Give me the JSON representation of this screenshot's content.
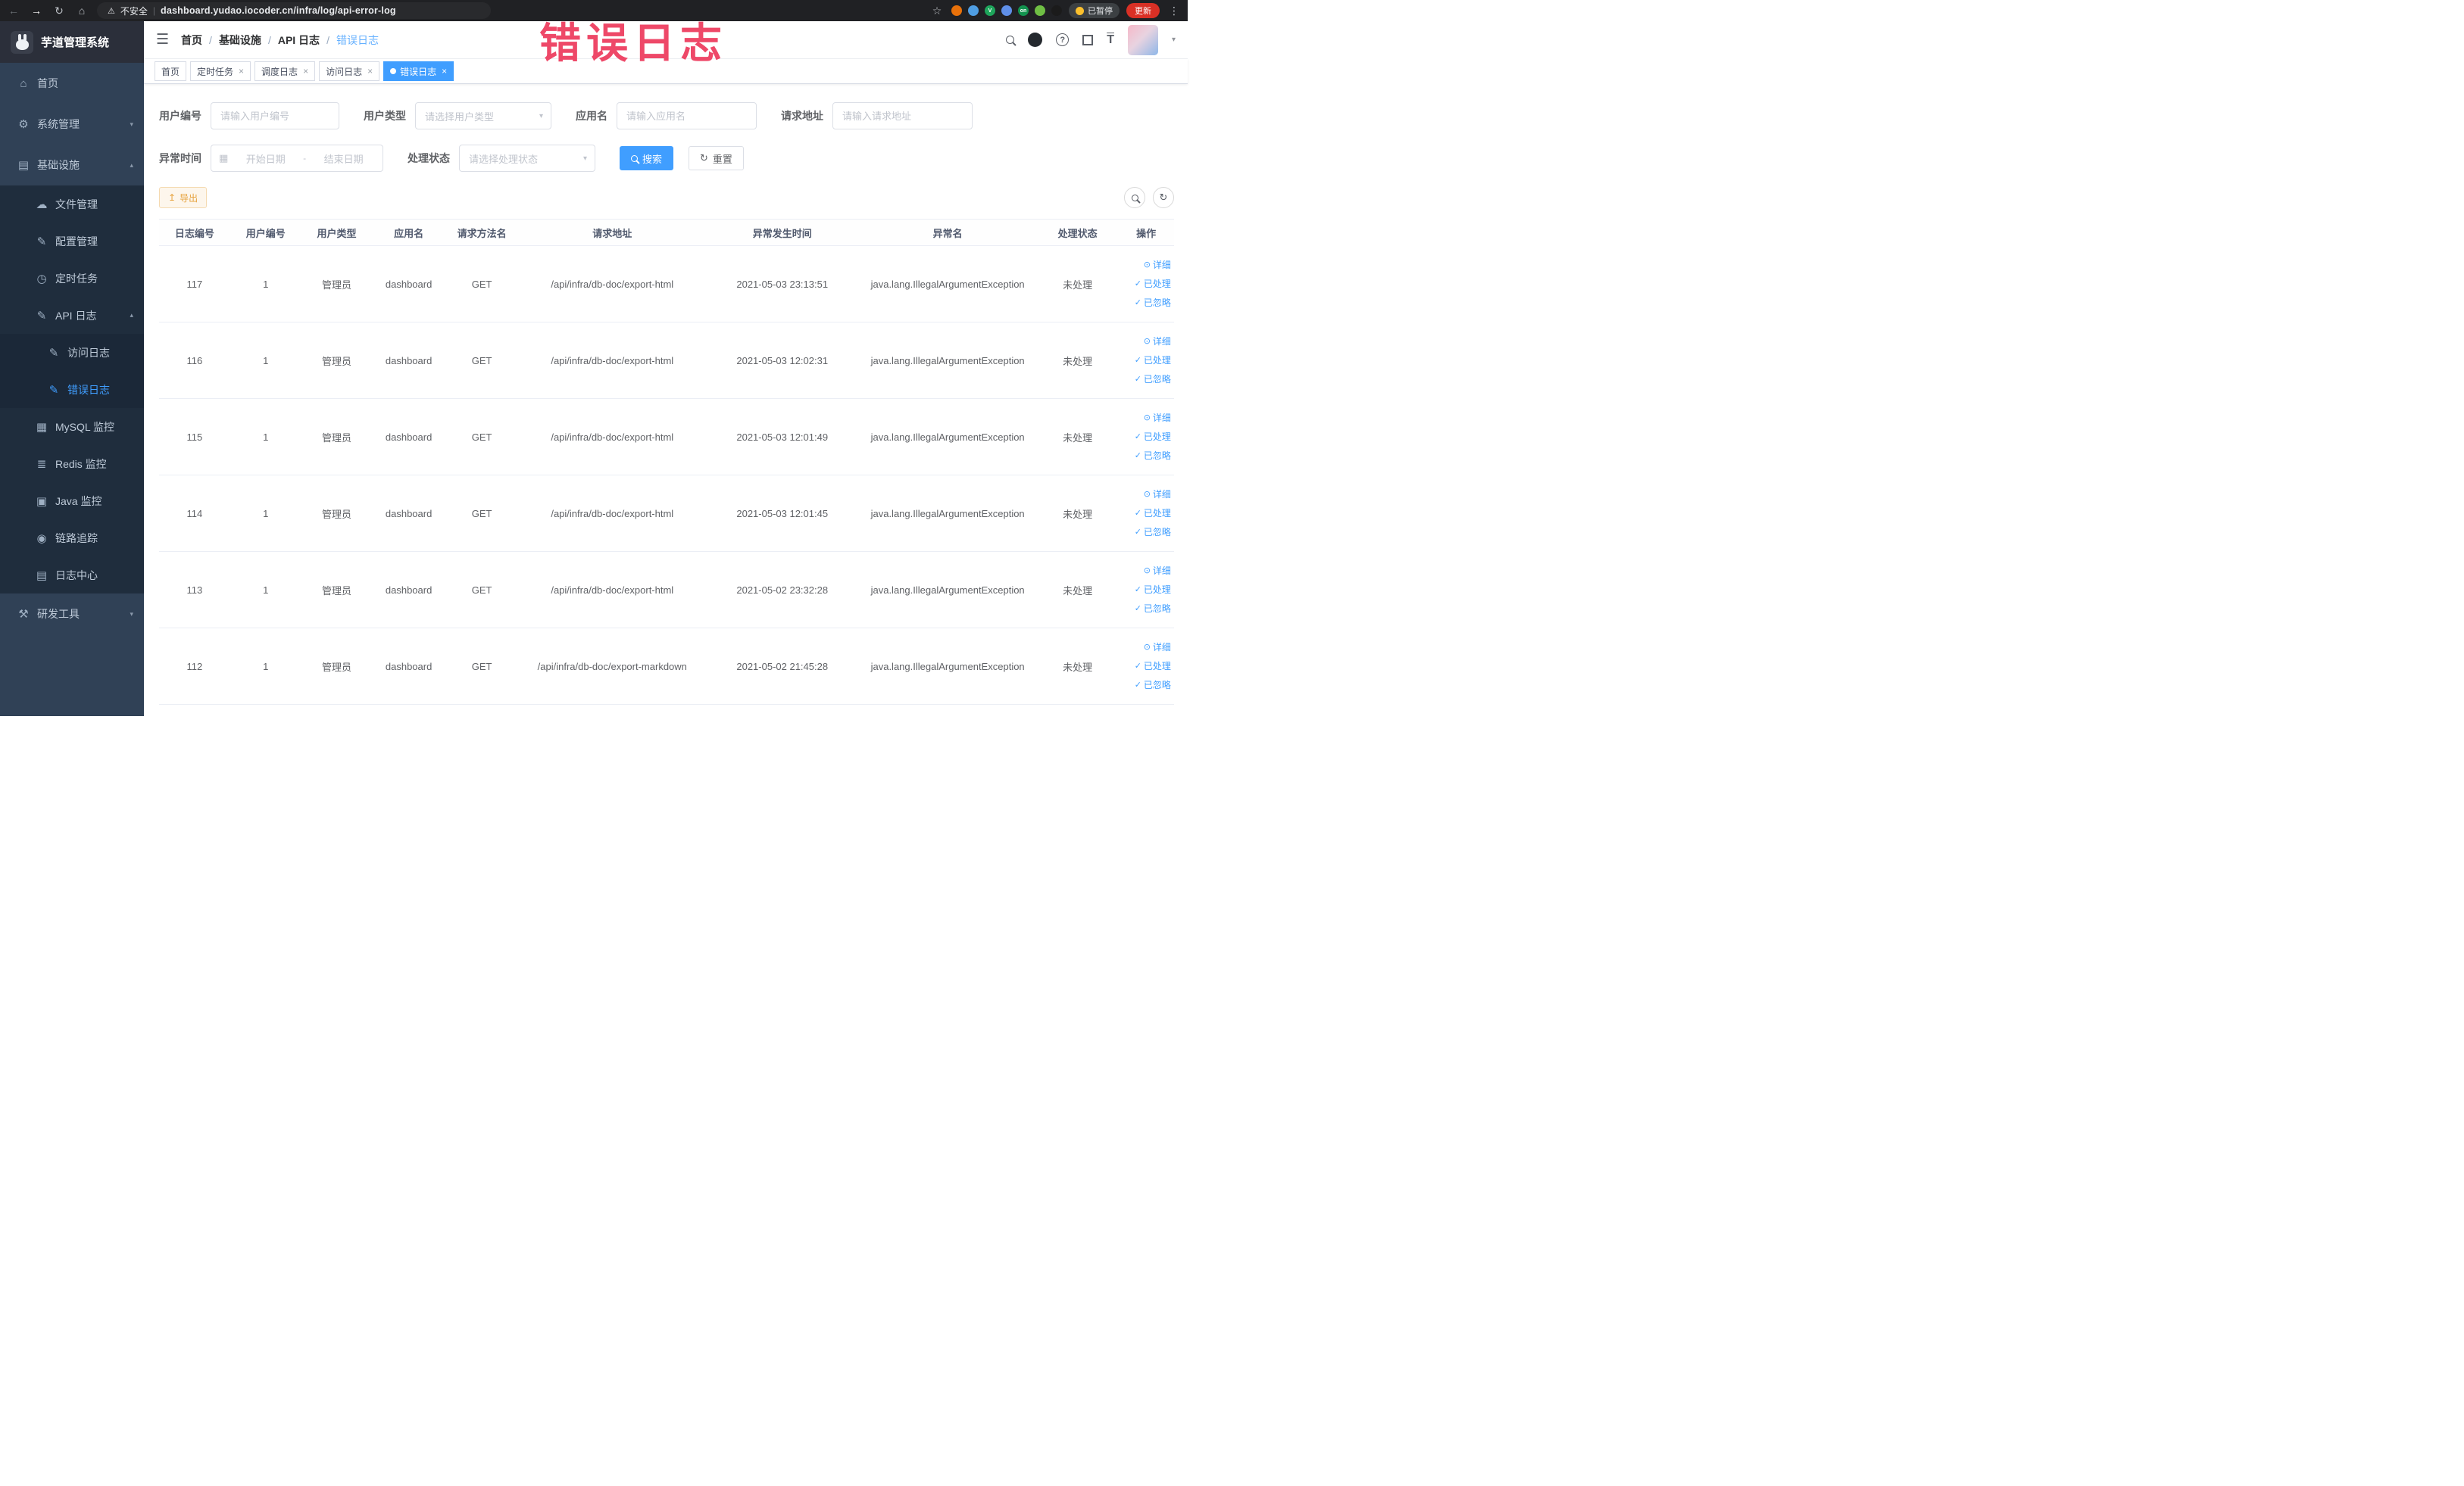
{
  "browser": {
    "security_label": "不安全",
    "url": "dashboard.yudao.iocoder.cn/infra/log/api-error-log",
    "paused_label": "已暂停",
    "update_label": "更新",
    "extensions": [
      {
        "name": "extension-orange-icon",
        "color": "#e8710a",
        "glyph": ""
      },
      {
        "name": "extension-drop-icon",
        "color": "#4f9ee3",
        "glyph": ""
      },
      {
        "name": "extension-video-icon",
        "color": "#1ea55b",
        "glyph": "V"
      },
      {
        "name": "extension-grid-icon",
        "color": "#5f8fe8",
        "glyph": ""
      },
      {
        "name": "extension-on-icon",
        "color": "#13934f",
        "glyph": "on"
      },
      {
        "name": "extension-leaf-icon",
        "color": "#6fbf44",
        "glyph": ""
      },
      {
        "name": "extension-paw-icon",
        "color": "#1b1b1b",
        "glyph": ""
      }
    ]
  },
  "watermark": "错误日志",
  "sidebar": {
    "logo_title": "芋道管理系统",
    "items": [
      {
        "id": "home",
        "label": "首页",
        "icon": "home-icon",
        "glyph": "⌂",
        "level": 0
      },
      {
        "id": "system",
        "label": "系统管理",
        "icon": "gear-icon",
        "glyph": "⚙",
        "level": 0,
        "chevron": "down"
      },
      {
        "id": "infra",
        "label": "基础设施",
        "icon": "grid-icon",
        "glyph": "▤",
        "level": 0,
        "chevron": "up"
      },
      {
        "id": "file-manage",
        "label": "文件管理",
        "icon": "cloud-icon",
        "glyph": "☁",
        "level": 1
      },
      {
        "id": "config-manage",
        "label": "配置管理",
        "icon": "edit-icon",
        "glyph": "✎",
        "level": 1
      },
      {
        "id": "cron-task",
        "label": "定时任务",
        "icon": "clock-icon",
        "glyph": "◷",
        "level": 1
      },
      {
        "id": "api-log",
        "label": "API 日志",
        "icon": "log-icon",
        "glyph": "✎",
        "level": 1,
        "chevron": "up"
      },
      {
        "id": "access-log",
        "label": "访问日志",
        "icon": "doc-icon",
        "glyph": "✎",
        "level": 2
      },
      {
        "id": "error-log",
        "label": "错误日志",
        "icon": "doc-icon",
        "glyph": "✎",
        "level": 2,
        "active": true
      },
      {
        "id": "mysql-monitor",
        "label": "MySQL 监控",
        "icon": "monitor-icon",
        "glyph": "▦",
        "level": 1
      },
      {
        "id": "redis-monitor",
        "label": "Redis 监控",
        "icon": "stack-icon",
        "glyph": "≣",
        "level": 1
      },
      {
        "id": "java-monitor",
        "label": "Java 监控",
        "icon": "java-icon",
        "glyph": "▣",
        "level": 1
      },
      {
        "id": "trace",
        "label": "链路追踪",
        "icon": "eye-icon",
        "glyph": "◉",
        "level": 1
      },
      {
        "id": "log-center",
        "label": "日志中心",
        "icon": "list-icon",
        "glyph": "▤",
        "level": 1
      },
      {
        "id": "dev-tools",
        "label": "研发工具",
        "icon": "tools-icon",
        "glyph": "⚒",
        "level": 0,
        "chevron": "down"
      }
    ]
  },
  "navbar": {
    "breadcrumb": [
      "首页",
      "基础设施",
      "API 日志",
      "错误日志"
    ]
  },
  "tabs": [
    {
      "id": "home",
      "label": "首页",
      "closable": false,
      "active": false
    },
    {
      "id": "cron-task",
      "label": "定时任务",
      "closable": true,
      "active": false
    },
    {
      "id": "schedule-log",
      "label": "调度日志",
      "closable": true,
      "active": false
    },
    {
      "id": "access-log",
      "label": "访问日志",
      "closable": true,
      "active": false
    },
    {
      "id": "error-log",
      "label": "错误日志",
      "closable": true,
      "active": true
    }
  ],
  "filters": {
    "fields": [
      {
        "label": "用户编号",
        "type": "input",
        "placeholder": "请输入用户编号"
      },
      {
        "label": "用户类型",
        "type": "select",
        "placeholder": "请选择用户类型"
      },
      {
        "label": "应用名",
        "type": "input",
        "placeholder": "请输入应用名"
      },
      {
        "label": "请求地址",
        "type": "input",
        "placeholder": "请输入请求地址"
      },
      {
        "label": "异常时间",
        "type": "daterange",
        "start_placeholder": "开始日期",
        "separator": "-",
        "end_placeholder": "结束日期"
      },
      {
        "label": "处理状态",
        "type": "select",
        "placeholder": "请选择处理状态"
      }
    ],
    "search_label": "搜索",
    "reset_label": "重置"
  },
  "toolbar": {
    "export_label": "导出"
  },
  "table": {
    "columns": [
      "日志编号",
      "用户编号",
      "用户类型",
      "应用名",
      "请求方法名",
      "请求地址",
      "异常发生时间",
      "异常名",
      "处理状态",
      "操作"
    ],
    "action_labels": {
      "detail": "详细",
      "processed": "已处理",
      "ignored": "已忽略"
    },
    "rows": [
      {
        "id": "117",
        "user_id": "1",
        "user_type": "管理员",
        "app": "dashboard",
        "method": "GET",
        "url": "/api/infra/db-doc/export-html",
        "time": "2021-05-03 23:13:51",
        "exception": "java.lang.IllegalArgumentException",
        "status": "未处理"
      },
      {
        "id": "116",
        "user_id": "1",
        "user_type": "管理员",
        "app": "dashboard",
        "method": "GET",
        "url": "/api/infra/db-doc/export-html",
        "time": "2021-05-03 12:02:31",
        "exception": "java.lang.IllegalArgumentException",
        "status": "未处理"
      },
      {
        "id": "115",
        "user_id": "1",
        "user_type": "管理员",
        "app": "dashboard",
        "method": "GET",
        "url": "/api/infra/db-doc/export-html",
        "time": "2021-05-03 12:01:49",
        "exception": "java.lang.IllegalArgumentException",
        "status": "未处理"
      },
      {
        "id": "114",
        "user_id": "1",
        "user_type": "管理员",
        "app": "dashboard",
        "method": "GET",
        "url": "/api/infra/db-doc/export-html",
        "time": "2021-05-03 12:01:45",
        "exception": "java.lang.IllegalArgumentException",
        "status": "未处理"
      },
      {
        "id": "113",
        "user_id": "1",
        "user_type": "管理员",
        "app": "dashboard",
        "method": "GET",
        "url": "/api/infra/db-doc/export-html",
        "time": "2021-05-02 23:32:28",
        "exception": "java.lang.IllegalArgumentException",
        "status": "未处理"
      },
      {
        "id": "112",
        "user_id": "1",
        "user_type": "管理员",
        "app": "dashboard",
        "method": "GET",
        "url": "/api/infra/db-doc/export-markdown",
        "time": "2021-05-02 21:45:28",
        "exception": "java.lang.IllegalArgumentException",
        "status": "未处理"
      }
    ]
  },
  "colors": {
    "accent": "#409eff",
    "sidebar_bg": "#304156",
    "submenu_bg": "#1f2d3d",
    "warning": "#e6a23c",
    "watermark": "#ee4868"
  }
}
